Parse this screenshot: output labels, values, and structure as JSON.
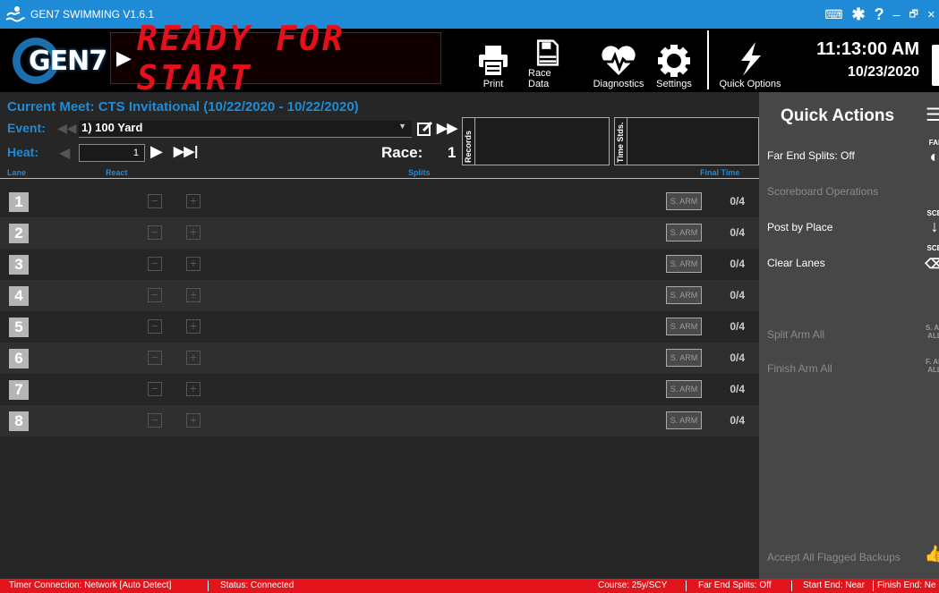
{
  "window": {
    "title": "GEN7 SWIMMING V1.6.1",
    "controls": [
      "⌨",
      "✱",
      "?",
      "–",
      "🗗",
      "✕"
    ]
  },
  "header": {
    "logo_text": "GEN7",
    "status_arrow": "▶",
    "status_text": "READY FOR START",
    "tools": [
      {
        "id": "print",
        "label": "Print",
        "icon": "printer-icon"
      },
      {
        "id": "race-data",
        "label": "Race Data",
        "icon": "race-data-icon"
      },
      {
        "id": "diagnostics",
        "label": "Diagnostics",
        "icon": "heartbeat-icon"
      },
      {
        "id": "settings",
        "label": "Settings",
        "icon": "gear-icon"
      },
      {
        "id": "quick-options",
        "label": "Quick Options",
        "icon": "lightning-icon"
      }
    ],
    "time": "11:13:00 AM",
    "date": "10/23/2020"
  },
  "meet": {
    "label": "Current Meet:",
    "name": "CTS Invitational (10/22/2020 - 10/22/2020)"
  },
  "event": {
    "label": "Event:",
    "value": "1) 100 Yard"
  },
  "heat": {
    "label": "Heat:",
    "value": "1"
  },
  "race": {
    "label": "Race:",
    "value": "1"
  },
  "records_label": "Records",
  "time_stds_label": "Time Stds.",
  "columns": {
    "lane": "Lane",
    "react": "React",
    "splits": "Splits",
    "final_time": "Final Time"
  },
  "lanes": [
    {
      "num": "1",
      "arm": "S. ARM",
      "count": "0/4"
    },
    {
      "num": "2",
      "arm": "S. ARM",
      "count": "0/4"
    },
    {
      "num": "3",
      "arm": "S. ARM",
      "count": "0/4"
    },
    {
      "num": "4",
      "arm": "S. ARM",
      "count": "0/4"
    },
    {
      "num": "5",
      "arm": "S. ARM",
      "count": "0/4"
    },
    {
      "num": "6",
      "arm": "S. ARM",
      "count": "0/4"
    },
    {
      "num": "7",
      "arm": "S. ARM",
      "count": "0/4"
    },
    {
      "num": "8",
      "arm": "S. ARM",
      "count": "0/4"
    }
  ],
  "quick_actions": {
    "title": "Quick Actions",
    "items": {
      "far_end_splits": "Far End Splits: Off",
      "scoreboard_ops": "Scoreboard Operations",
      "post_by_place": "Post by Place",
      "clear_lanes": "Clear Lanes",
      "split_arm_all": "Split Arm All",
      "finish_arm_all": "Finish Arm All",
      "accept_backups": "Accept All Flagged Backups"
    },
    "side": {
      "far": "FAI",
      "scb1": "SCB",
      "scb2": "SCB",
      "s_arm_all": "S. AF\nALL",
      "f_arm_all": "F. AR\nALL"
    }
  },
  "statusbar": {
    "timer": "Timer Connection: Network [Auto Detect]",
    "status": "Status: Connected",
    "course": "Course: 25y/SCY",
    "far_end": "Far End Splits: Off",
    "start_end": "Start End: Near",
    "finish_end": "Finish End: Ne"
  },
  "colors": {
    "accent": "#1f8bd6",
    "led": "#e4101c",
    "statusbar": "#e3141c"
  }
}
